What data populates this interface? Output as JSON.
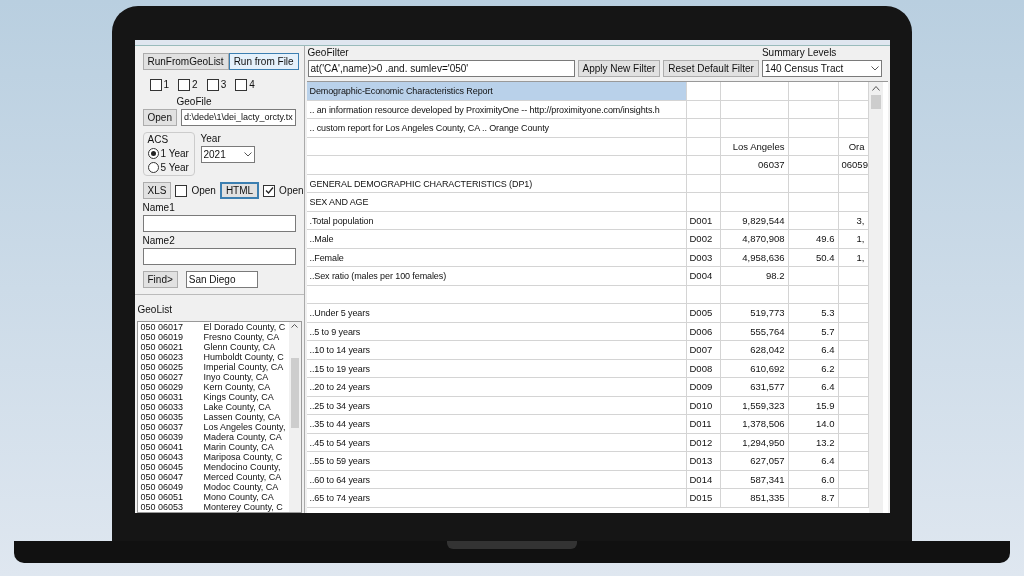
{
  "controls": {
    "run_from_geolist": "RunFromGeoList",
    "run_from_file": "Run from File",
    "checkboxes": [
      {
        "label": "1",
        "checked": false
      },
      {
        "label": "2",
        "checked": false
      },
      {
        "label": "3",
        "checked": false
      },
      {
        "label": "4",
        "checked": false
      }
    ],
    "geofile": {
      "label": "GeoFile",
      "button": "Open",
      "value": "d:\\dede\\1\\dei_lacty_orcty.tx"
    },
    "acs": {
      "label": "ACS",
      "options": [
        {
          "label": "1 Year",
          "selected": true
        },
        {
          "label": "5 Year",
          "selected": false
        }
      ]
    },
    "year": {
      "label": "Year",
      "value": "2021"
    },
    "outputs": [
      {
        "button": "XLS",
        "focused": false,
        "open_label": "Open",
        "checked": false
      },
      {
        "button": "HTML",
        "focused": true,
        "open_label": "Open",
        "checked": true
      }
    ],
    "name1": {
      "label": "Name1"
    },
    "name2": {
      "label": "Name2"
    },
    "find": {
      "button": "Find>",
      "value": "San Diego"
    }
  },
  "geolist": {
    "label": "GeoList",
    "items": [
      {
        "code": "050 06017",
        "name": "El Dorado County, C"
      },
      {
        "code": "050 06019",
        "name": "Fresno County, CA"
      },
      {
        "code": "050 06021",
        "name": "Glenn County, CA"
      },
      {
        "code": "050 06023",
        "name": "Humboldt County, C"
      },
      {
        "code": "050 06025",
        "name": "Imperial County, CA"
      },
      {
        "code": "050 06027",
        "name": "Inyo County, CA"
      },
      {
        "code": "050 06029",
        "name": "Kern County, CA"
      },
      {
        "code": "050 06031",
        "name": "Kings County, CA"
      },
      {
        "code": "050 06033",
        "name": "Lake County, CA"
      },
      {
        "code": "050 06035",
        "name": "Lassen County, CA"
      },
      {
        "code": "050 06037",
        "name": "Los Angeles County,"
      },
      {
        "code": "050 06039",
        "name": "Madera County, CA"
      },
      {
        "code": "050 06041",
        "name": "Marin County, CA"
      },
      {
        "code": "050 06043",
        "name": "Mariposa County, C"
      },
      {
        "code": "050 06045",
        "name": "Mendocino County,"
      },
      {
        "code": "050 06047",
        "name": "Merced County, CA"
      },
      {
        "code": "050 06049",
        "name": "Modoc County, CA"
      },
      {
        "code": "050 06051",
        "name": "Mono County, CA"
      },
      {
        "code": "050 06053",
        "name": "Monterey County, C"
      }
    ]
  },
  "geofilter": {
    "label": "GeoFilter",
    "value": "at('CA',name)>0 .and. sumlev='050'",
    "apply": "Apply New Filter",
    "reset": "Reset Default Filter"
  },
  "summary_levels": {
    "label": "Summary Levels",
    "value": "140 Census Tract"
  },
  "table": {
    "rows": [
      {
        "selected": true,
        "cells": [
          "Demographic-Economic Characteristics Report",
          "",
          "",
          "",
          ""
        ]
      },
      {
        "selected": false,
        "cells": [
          ".. an information resource developed by ProximityOne -- http://proximityone.com/insights.h",
          "",
          "",
          "",
          ""
        ]
      },
      {
        "selected": false,
        "cells": [
          ".. custom report for      Los Angeles County, CA ..      Orange County",
          "",
          "",
          "",
          ""
        ]
      },
      {
        "selected": false,
        "cells": [
          "",
          "",
          "Los Angeles",
          "",
          "Ora"
        ]
      },
      {
        "selected": false,
        "cells": [
          "",
          "",
          "06037",
          "",
          "06059"
        ]
      },
      {
        "selected": false,
        "cells": [
          "GENERAL DEMOGRAPHIC CHARACTERISTICS (DP1)",
          "",
          "",
          "",
          ""
        ]
      },
      {
        "selected": false,
        "cells": [
          "SEX AND AGE",
          "",
          "",
          "",
          ""
        ]
      },
      {
        "selected": false,
        "cells": [
          ".Total population",
          "D001",
          "9,829,544",
          "",
          "3,"
        ]
      },
      {
        "selected": false,
        "cells": [
          "..Male",
          "D002",
          "4,870,908",
          "49.6",
          "1,"
        ]
      },
      {
        "selected": false,
        "cells": [
          "..Female",
          "D003",
          "4,958,636",
          "50.4",
          "1,"
        ]
      },
      {
        "selected": false,
        "cells": [
          "..Sex ratio (males per 100 females)",
          "D004",
          "98.2",
          "",
          ""
        ]
      },
      {
        "selected": false,
        "cells": [
          "",
          "",
          "",
          "",
          ""
        ]
      },
      {
        "selected": false,
        "cells": [
          "..Under 5 years",
          "D005",
          "519,773",
          "5.3",
          ""
        ]
      },
      {
        "selected": false,
        "cells": [
          "..5 to 9 years",
          "D006",
          "555,764",
          "5.7",
          ""
        ]
      },
      {
        "selected": false,
        "cells": [
          "..10 to 14 years",
          "D007",
          "628,042",
          "6.4",
          ""
        ]
      },
      {
        "selected": false,
        "cells": [
          "..15 to 19 years",
          "D008",
          "610,692",
          "6.2",
          ""
        ]
      },
      {
        "selected": false,
        "cells": [
          "..20 to 24 years",
          "D009",
          "631,577",
          "6.4",
          ""
        ]
      },
      {
        "selected": false,
        "cells": [
          "..25 to 34 years",
          "D010",
          "1,559,323",
          "15.9",
          ""
        ]
      },
      {
        "selected": false,
        "cells": [
          "..35 to 44 years",
          "D011",
          "1,378,506",
          "14.0",
          ""
        ]
      },
      {
        "selected": false,
        "cells": [
          "..45 to 54 years",
          "D012",
          "1,294,950",
          "13.2",
          ""
        ]
      },
      {
        "selected": false,
        "cells": [
          "..55 to 59 years",
          "D013",
          "627,057",
          "6.4",
          ""
        ]
      },
      {
        "selected": false,
        "cells": [
          "..60 to 64 years",
          "D014",
          "587,341",
          "6.0",
          ""
        ]
      },
      {
        "selected": false,
        "cells": [
          "..65 to 74 years",
          "D015",
          "851,335",
          "8.7",
          ""
        ]
      }
    ]
  }
}
